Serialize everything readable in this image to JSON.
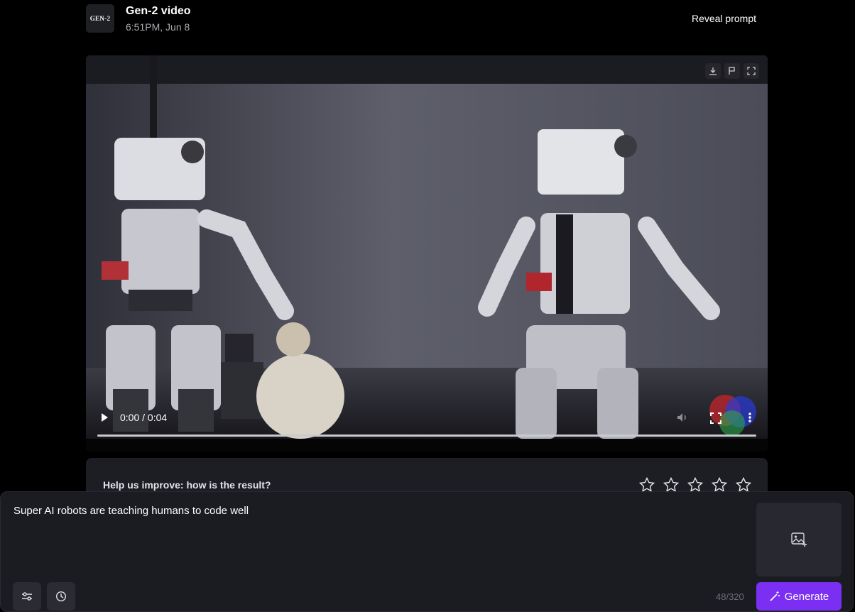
{
  "header": {
    "logo_text": "GEN-2",
    "title": "Gen-2 video",
    "timestamp": "6:51PM, Jun 8",
    "reveal_prompt": "Reveal prompt"
  },
  "video": {
    "current_time": "0:00 / 0:04",
    "progress": 0,
    "corner_tools": [
      "download-icon",
      "flag-icon",
      "expand-icon"
    ],
    "controls": [
      "play-icon",
      "volume-icon",
      "fullscreen-icon",
      "more-vert-icon"
    ]
  },
  "feedback": {
    "question": "Help us improve: how is the result?",
    "stars_total": 5
  },
  "prompt": {
    "text": "Super AI robots are teaching humans to code well",
    "char_count": "48/320",
    "generate_label": "Generate",
    "tools": [
      "settings-sliders-icon",
      "history-icon"
    ],
    "image_upload_icon": "add-image-icon"
  },
  "colors": {
    "accent": "#7b2ff2",
    "background": "#000000",
    "panel": "#1b1c22"
  }
}
